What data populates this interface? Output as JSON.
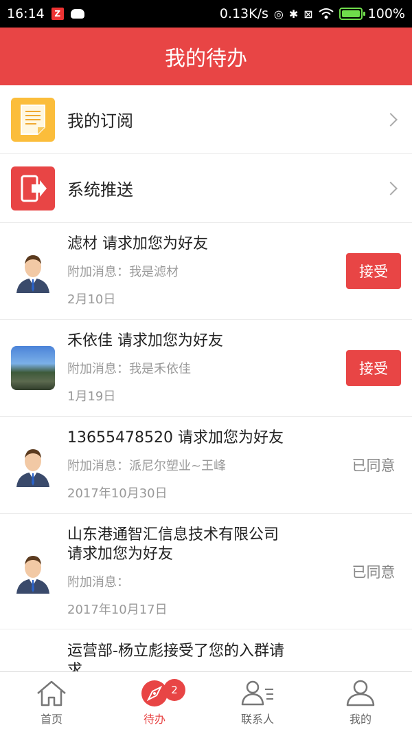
{
  "status_bar": {
    "time": "16:14",
    "app_icon_letter": "Z",
    "network_speed": "0.13K/s",
    "battery_percent": "100%",
    "battery_level": 1.0
  },
  "header": {
    "title": "我的待办"
  },
  "nav_items": [
    {
      "label": "我的订阅",
      "icon": "document-icon"
    },
    {
      "label": "系统推送",
      "icon": "phone-exit-icon"
    }
  ],
  "requests": [
    {
      "title": "滤材 请求加您为好友",
      "message": "附加消息：我是滤材",
      "date": "2月10日",
      "action": "接受"
    },
    {
      "title": "禾依佳 请求加您为好友",
      "message": "附加消息：我是禾依佳",
      "date": "1月19日",
      "action": "接受"
    },
    {
      "title": "13655478520 请求加您为好友",
      "message": "附加消息：派尼尔塑业~王峰",
      "date": "2017年10月30日",
      "status": "已同意"
    },
    {
      "title_line1": "山东港通智汇信息技术有限公司",
      "title_line2": "请求加您为好友",
      "message": "附加消息：",
      "date": "2017年10月17日",
      "status": "已同意"
    },
    {
      "title_line1": "运营部-杨立彪接受了您的入群请",
      "title_line2": "求"
    }
  ],
  "tabbar": {
    "tabs": [
      {
        "label": "首页"
      },
      {
        "label": "待办",
        "badge": "2"
      },
      {
        "label": "联系人"
      },
      {
        "label": "我的"
      }
    ]
  },
  "colors": {
    "primary": "#e84545",
    "subscription_icon_bg": "#fbbd3b"
  }
}
